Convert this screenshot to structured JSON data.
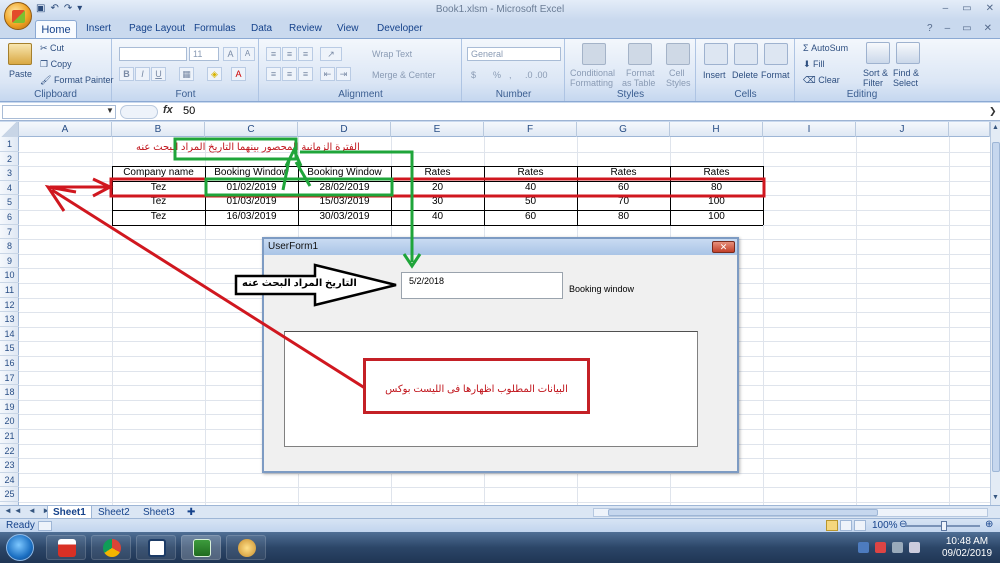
{
  "window": {
    "title": "Book1.xlsm - Microsoft Excel",
    "qat_undo": "↶",
    "qat_redo": "↷",
    "qat_more": "▾",
    "min": "–",
    "restore": "▭",
    "close": "✕"
  },
  "tabs": [
    "Home",
    "Insert",
    "Page Layout",
    "Formulas",
    "Data",
    "Review",
    "View",
    "Developer"
  ],
  "ribbon": {
    "clipboard": {
      "label": "Clipboard",
      "paste": "Paste",
      "cut": "Cut",
      "copy": "Copy",
      "format_painter": "Format Painter"
    },
    "font": {
      "label": "Font",
      "size": "11",
      "bold": "B",
      "italic": "I",
      "underline": "U",
      "grow": "A",
      "shrink": "A"
    },
    "alignment": {
      "label": "Alignment",
      "wrap_text": "Wrap Text",
      "merge_center": "Merge & Center"
    },
    "number": {
      "label": "Number",
      "format": "General",
      "currency": "$",
      "percent": "%",
      "comma": ",",
      "inc_dec": ".0  .00"
    },
    "styles": {
      "label": "Styles",
      "conditional": "Conditional",
      "conditional2": "Formatting",
      "format_as": "Format",
      "format_as2": "as Table",
      "cell": "Cell",
      "cell2": "Styles"
    },
    "cells": {
      "label": "Cells",
      "insert": "Insert",
      "delete": "Delete",
      "format": "Format"
    },
    "editing": {
      "label": "Editing",
      "autosum": "Σ AutoSum",
      "fill": "Fill",
      "clear": "Clear",
      "sort": "Sort &",
      "sort2": "Filter",
      "find": "Find &",
      "find2": "Select"
    }
  },
  "formula_bar": {
    "namebox": "",
    "fx": "fx",
    "value": "50"
  },
  "columns": [
    "A",
    "B",
    "C",
    "D",
    "E",
    "F",
    "G",
    "H",
    "I",
    "J"
  ],
  "rows": [
    "1",
    "2",
    "3",
    "4",
    "5",
    "6",
    "7",
    "8",
    "9",
    "10",
    "11",
    "12",
    "13",
    "14",
    "15",
    "16",
    "17",
    "18",
    "19",
    "20",
    "21",
    "22",
    "23",
    "24",
    "25"
  ],
  "table": {
    "headers": [
      "Company name",
      "Booking Window",
      "Booking Window",
      "Rates",
      "Rates",
      "Rates",
      "Rates"
    ],
    "rows": [
      [
        "Tez",
        "01/02/2019",
        "28/02/2019",
        "20",
        "40",
        "60",
        "80"
      ],
      [
        "Tez",
        "01/03/2019",
        "15/03/2019",
        "30",
        "50",
        "70",
        "100"
      ],
      [
        "Tez",
        "16/03/2019",
        "30/03/2019",
        "40",
        "60",
        "80",
        "100"
      ]
    ]
  },
  "annotations": {
    "period_note": "الفترة الزمانية المحصور بينهما التاريخ المراد البحث عنه",
    "search_date_arrow": "التاريخ المراد البحث عنه",
    "listbox_note": "البيانات المطلوب اظهارها فى الليست بوكس"
  },
  "userform": {
    "title": "UserForm1",
    "close": "✕",
    "textbox_value": "5/2/2018",
    "label": "Booking window"
  },
  "sheets": [
    "Sheet1",
    "Sheet2",
    "Sheet3"
  ],
  "status": {
    "ready": "Ready",
    "zoom": "100%"
  },
  "clock": {
    "time": "10:48 AM",
    "date": "09/02/2019"
  },
  "colors": {
    "red": "#d0171f",
    "green": "#1fa53a",
    "excel_blue": "#15428b"
  }
}
